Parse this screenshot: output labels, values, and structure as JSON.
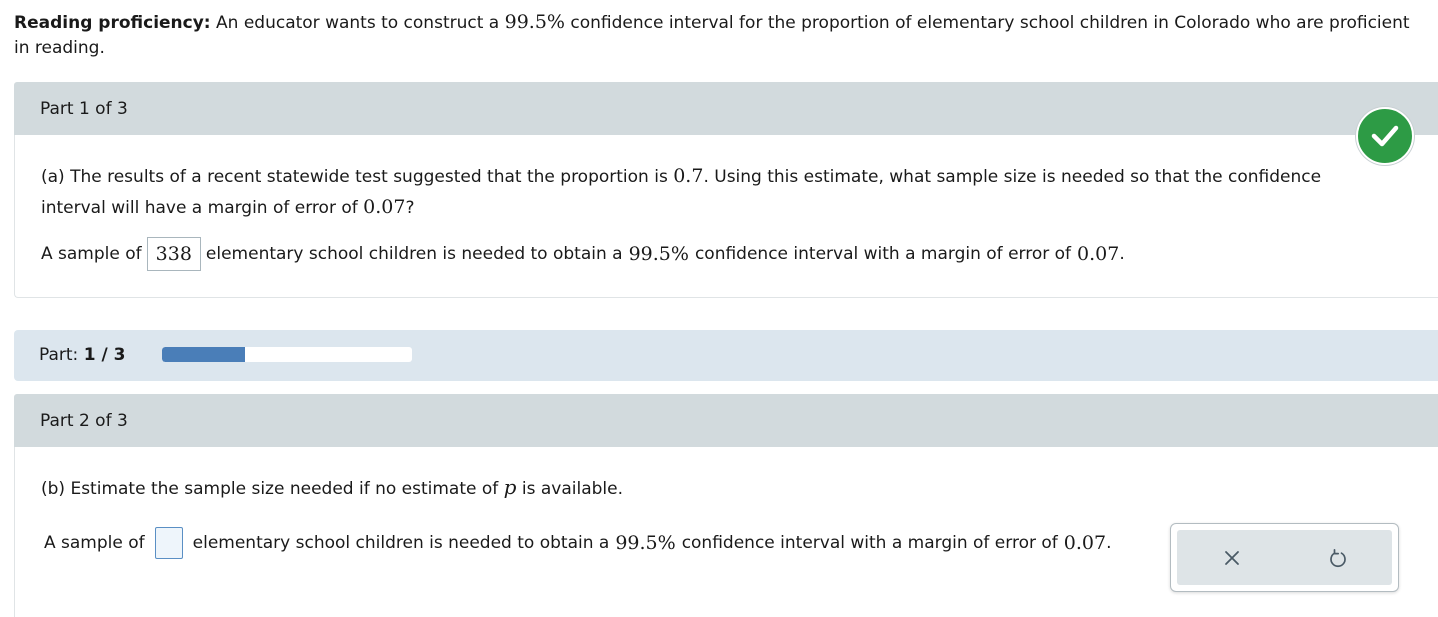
{
  "intro": {
    "title": "Reading proficiency:",
    "text_a": " An educator wants to construct a ",
    "conf": "99.5%",
    "text_b": " confidence interval for the proportion of elementary school children in Colorado who are proficient in reading."
  },
  "part1": {
    "header": "Part 1 of 3",
    "q_a": "(a) The results of a recent statewide test suggested that the proportion is ",
    "q_p": "0.7",
    "q_b": ". Using this estimate, what sample size is needed so that the confidence interval will have a margin of error of ",
    "q_moe": "0.07",
    "q_c": "?",
    "ans_pre": "A sample of",
    "ans_value": "338",
    "ans_mid": "elementary school children is needed to obtain a ",
    "ans_conf": "99.5%",
    "ans_mid2": " confidence interval with a margin of error of ",
    "ans_moe": "0.07",
    "ans_end": ".",
    "status_icon": "check-circle-icon",
    "status_color": "#2d9b45"
  },
  "progress": {
    "label": "Part: ",
    "current": "1 / 3",
    "fraction": 0.333,
    "fill_color": "#4a7eb8"
  },
  "part2": {
    "header": "Part 2 of 3",
    "q_a": "(b) Estimate the sample size needed if no estimate of ",
    "q_var": "p",
    "q_b": " is available.",
    "ans_pre": "A sample of",
    "ans_value": "",
    "ans_mid": "elementary school children is needed to obtain a ",
    "ans_conf": "99.5%",
    "ans_mid2": " confidence interval with a margin of error of ",
    "ans_moe": "0.07",
    "ans_end": "."
  },
  "tools": {
    "clear_icon": "close-icon",
    "undo_icon": "undo-icon"
  }
}
